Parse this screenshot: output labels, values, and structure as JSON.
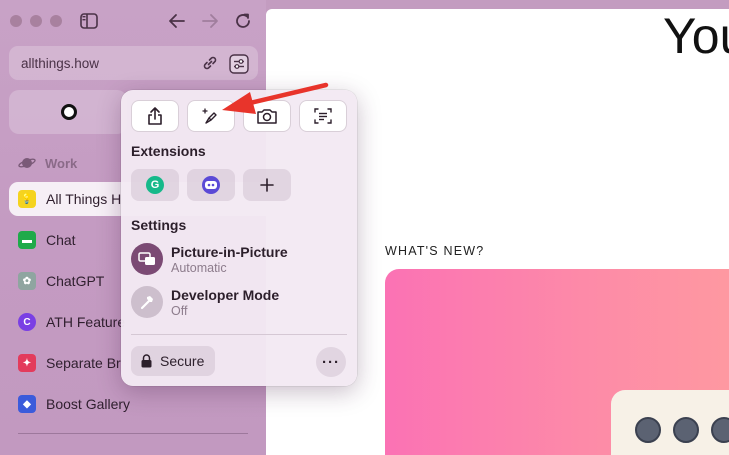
{
  "sidebar": {
    "url": "allthings.how",
    "space_label": "Work",
    "tabs": [
      {
        "label": "All Things H",
        "color": "#f5d31f",
        "active": true
      },
      {
        "label": "Chat",
        "color": "#1faa4a"
      },
      {
        "label": "ChatGPT",
        "color": "#8fa5a0"
      },
      {
        "label": "ATH Feature",
        "color": "#7a3fe4"
      },
      {
        "label": "Separate Br",
        "color": "#e33b5c"
      },
      {
        "label": "Boost Gallery",
        "color": "#3b5bdb"
      }
    ]
  },
  "main": {
    "heading_partial": "You",
    "whats_new": "WHAT'S NEW?"
  },
  "popup": {
    "extensions_label": "Extensions",
    "settings_label": "Settings",
    "settings": [
      {
        "title": "Picture-in-Picture",
        "subtitle": "Automatic"
      },
      {
        "title": "Developer Mode",
        "subtitle": "Off"
      }
    ],
    "secure_label": "Secure",
    "more_label": "···"
  },
  "colors": {
    "sidebar_bg": "#c49bc2",
    "arrow": "#e8342b",
    "hero_gradient_start": "#fb72b4",
    "hero_gradient_end": "#fe9aa0"
  }
}
